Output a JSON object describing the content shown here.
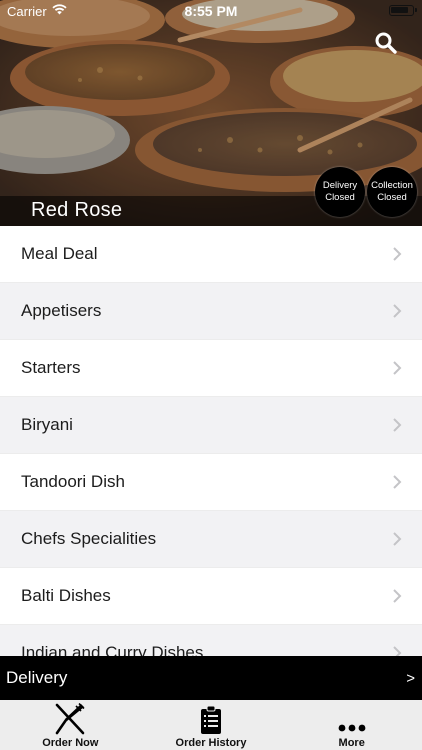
{
  "status_bar": {
    "carrier": "Carrier",
    "time": "8:55 PM"
  },
  "header": {
    "restaurant_name": "Red Rose",
    "search_icon": "search-icon",
    "delivery_status": {
      "line1": "Delivery",
      "line2": "Closed"
    },
    "collection_status": {
      "line1": "Collection",
      "line2": "Closed"
    }
  },
  "menu": {
    "categories": [
      {
        "label": "Meal Deal"
      },
      {
        "label": "Appetisers"
      },
      {
        "label": "Starters"
      },
      {
        "label": "Biryani"
      },
      {
        "label": "Tandoori Dish"
      },
      {
        "label": "Chefs Specialities"
      },
      {
        "label": "Balti Dishes"
      },
      {
        "label": "Indian and Curry Dishes"
      }
    ]
  },
  "order_mode": {
    "label": "Delivery",
    "arrow": ">"
  },
  "tab_bar": {
    "tabs": [
      {
        "label": "Order Now",
        "icon": "fork-knife-icon"
      },
      {
        "label": "Order History",
        "icon": "clipboard-icon"
      },
      {
        "label": "More",
        "icon": "more-dots-icon"
      }
    ]
  }
}
